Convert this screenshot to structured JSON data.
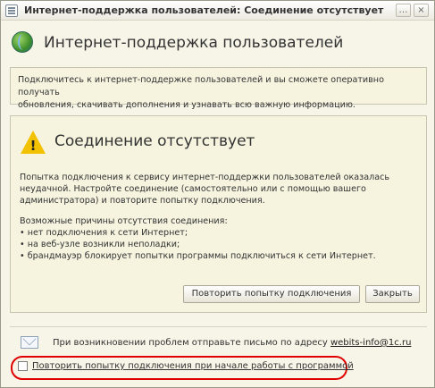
{
  "window": {
    "title": "Интернет-поддержка пользователей: Соединение отсутствует",
    "buttons": [
      "…",
      "×"
    ]
  },
  "header": {
    "title": "Интернет-поддержка пользователей"
  },
  "info": {
    "line1": "Подключитесь к интернет-поддержке пользователей и вы сможете оперативно получать",
    "line2": "обновления, скачивать дополнения и узнавать всю важную информацию."
  },
  "status": {
    "title": "Соединение отсутствует",
    "icon": "warning-icon",
    "desc_line1": "Попытка подключения к сервису интернет-поддержки пользователей оказалась",
    "desc_line2": "неудачной. Настройте соединение (самостоятельно или с помощью вашего",
    "desc_line3": "администратора) и повторите попытку подключения.",
    "reasons_title": "Возможные причины отсутствия соединения:",
    "reasons": [
      "• нет подключения к сети Интернет;",
      "• на веб-узле возникли неполадки;",
      "• брандмауэр блокирует попытки программы подключиться к сети Интернет."
    ]
  },
  "actions": {
    "retry_label": "Повторить попытку подключения",
    "close_label": "Закрыть"
  },
  "footer": {
    "mail_text": "При возникновении проблем отправьте письмо по адресу",
    "mail_link": "webits-info@1c.ru",
    "checkbox_label": "Повторить попытку подключения при начале работы с программой",
    "checkbox_checked": false
  }
}
